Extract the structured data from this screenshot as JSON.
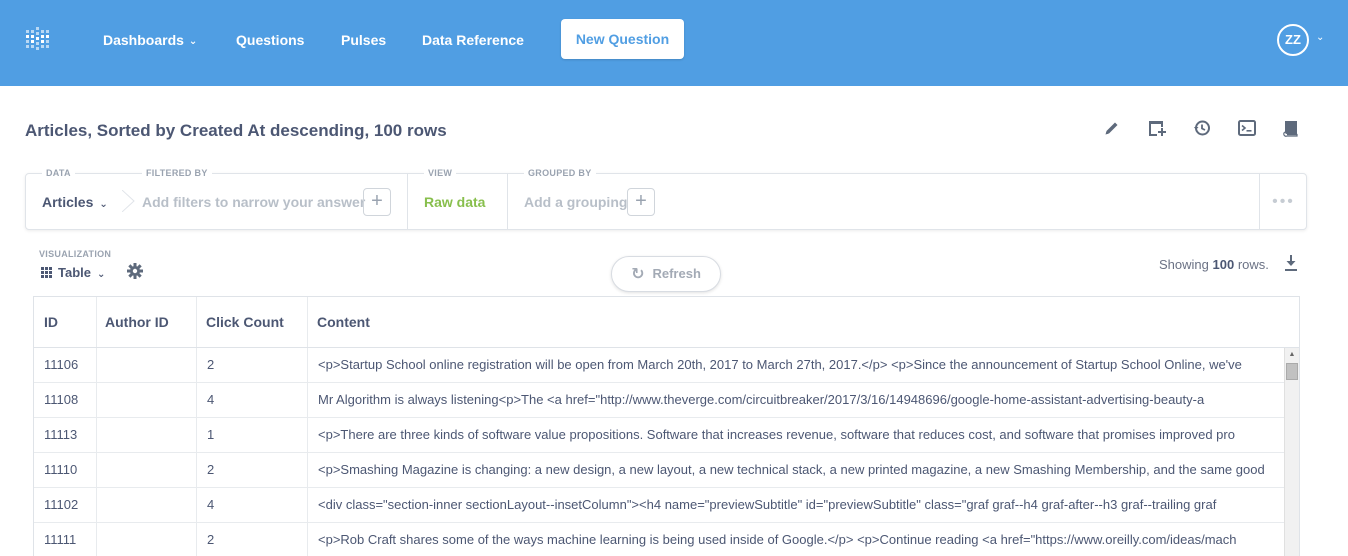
{
  "nav": {
    "links": [
      "Dashboards",
      "Questions",
      "Pulses",
      "Data Reference"
    ],
    "new_question": "New Question",
    "avatar": "ZZ"
  },
  "header": {
    "title": "Articles, Sorted by Created At descending, 100 rows"
  },
  "query": {
    "data_label": "DATA",
    "data_value": "Articles",
    "filter_label": "FILTERED BY",
    "filter_placeholder": "Add filters to narrow your answer",
    "view_label": "VIEW",
    "view_value": "Raw data",
    "group_label": "GROUPED BY",
    "group_placeholder": "Add a grouping"
  },
  "viz": {
    "label": "VISUALIZATION",
    "type": "Table",
    "refresh": "Refresh",
    "showing_prefix": "Showing",
    "showing_count": "100",
    "showing_suffix": "rows."
  },
  "table": {
    "columns": [
      "ID",
      "Author ID",
      "Click Count",
      "Content"
    ],
    "rows": [
      [
        "11106",
        "",
        "2",
        "<p>Startup School online registration will be open from March 20th, 2017 to March 27th, 2017.</p> <p>Since the announcement of Startup School Online, we've"
      ],
      [
        "11108",
        "",
        "4",
        "Mr Algorithm is always listening<p>The <a href=\"http://www.theverge.com/circuitbreaker/2017/3/16/14948696/google-home-assistant-advertising-beauty-a"
      ],
      [
        "11113",
        "",
        "1",
        "<p>There are three kinds of software value propositions. Software that increases revenue, software that reduces cost, and software that promises improved pro"
      ],
      [
        "11110",
        "",
        "2",
        "<p>Smashing Magazine is changing: a new design, a new layout, a new technical stack, a new printed magazine, a new Smashing Membership, and the same good"
      ],
      [
        "11102",
        "",
        "4",
        "<div class=\"section-inner sectionLayout--insetColumn\"><h4 name=\"previewSubtitle\" id=\"previewSubtitle\" class=\"graf graf--h4 graf-after--h3 graf--trailing graf"
      ],
      [
        "11111",
        "",
        "2",
        "<p>Rob Craft shares some of the ways machine learning is being used inside of Google.</p> <p>Continue reading <a href=\"https://www.oreilly.com/ideas/mach"
      ]
    ]
  },
  "colors": {
    "nav_bg": "#509ee3",
    "view_green": "#88bf4d",
    "text": "#4c5773"
  }
}
